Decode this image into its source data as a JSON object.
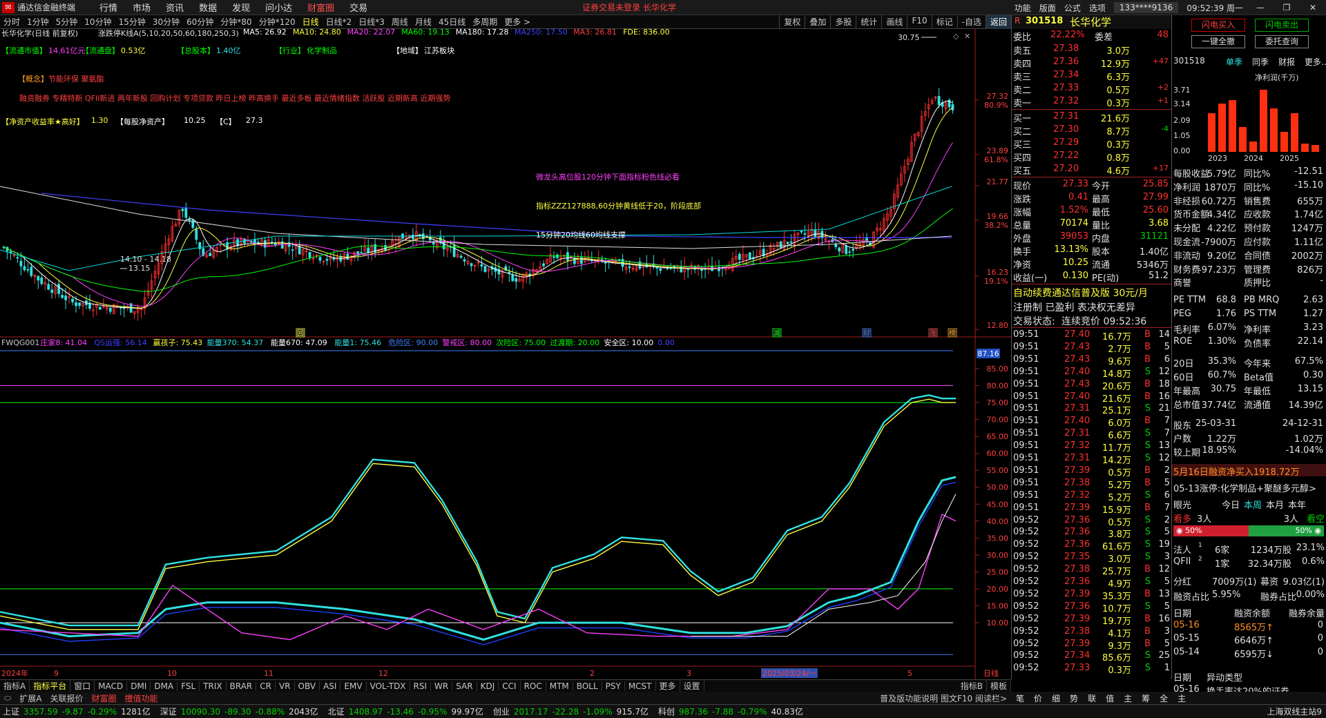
{
  "menubar": {
    "app": "通达信金融终端",
    "items": [
      "行情",
      "市场",
      "资讯",
      "数据",
      "发现",
      "问小达",
      "财富圈",
      "交易"
    ],
    "active": "财富圈",
    "warning": "证券交易未登录  长华化学",
    "right": [
      "功能",
      "版面",
      "公式",
      "选项"
    ],
    "account": "133****9136",
    "clock": "09:52:39 周一"
  },
  "periods": [
    "分时",
    "1分钟",
    "5分钟",
    "10分钟",
    "15分钟",
    "30分钟",
    "60分钟",
    "分钟*80",
    "分钟*120",
    "日线",
    "日线*2",
    "日线*3",
    "周线",
    "月线",
    "45日线",
    "多周期",
    "更多 >"
  ],
  "period_selected": "日线",
  "toolbar_right": [
    "复权",
    "叠加",
    "多股",
    "统计",
    "画线",
    "F10",
    "标记",
    "-自选",
    "返回"
  ],
  "chart_header": {
    "title": "长华化学(日线 前复权)",
    "indicator": "涨跌停K线A(5,10,20,50,60,180,250,3)",
    "ma": [
      {
        "t": "MA5: 26.92",
        "c": "#ffffff"
      },
      {
        "t": "MA10: 24.80",
        "c": "#ffff40"
      },
      {
        "t": "MA20: 22.07",
        "c": "#ff40ff"
      },
      {
        "t": "MA60: 19.13",
        "c": "#00ff00"
      },
      {
        "t": "MA180: 17.28",
        "c": "#ffffff"
      },
      {
        "t": "MA250: 17.50",
        "c": "#4040ff"
      },
      {
        "t": "MA3: 26.81",
        "c": "#ff4040"
      },
      {
        "t": "FDE: 836.00",
        "c": "#ffff40"
      }
    ]
  },
  "info": {
    "mktcap_label": "【流通市值】",
    "mktcap": "14.61亿元",
    "float_label": "【流通盘】",
    "float": "0.53亿",
    "total_label": "【总股本】",
    "total": "1.40亿",
    "ind_label": "【行业】",
    "ind": "化学制品",
    "region_label": "【地域】",
    "region": "江苏板块",
    "concept_label": "【概念】",
    "concept": "节能环保 聚氨酯",
    "tags": "融资融券 专精特新 QFII新进 两年新股 回购计划 专项贷款 昨日上榜 昨高换手 最近多板 最近情绪指数 活跃股 近期新高 近期强势",
    "roe_label": "【净资产收益率★高好】",
    "roe": "1.30",
    "bvps_label": "【每股净资产】",
    "bvps": "10.25",
    "c_label": "【C】",
    "c": "27.3"
  },
  "notes": [
    "微龙头高位股120分钟下面指标粉色线必看",
    "指标ZZZ127888,60分钟黄线低于20，阶段底部",
    "15分钟20均线60均线支撑"
  ],
  "price_labels": {
    "high": "30.75",
    "low": "13.15",
    "range": "14.10 - 14.18"
  },
  "y_axis_main": [
    {
      "v": "27.32",
      "p": "80.9%"
    },
    {
      "v": "23.89",
      "p": "61.8%"
    },
    {
      "v": "21.77",
      "p": ""
    },
    {
      "v": "19.66",
      "p": "38.2%"
    },
    {
      "v": "16.23",
      "p": "19.1%"
    },
    {
      "v": "12.80",
      "p": ""
    }
  ],
  "markers": [
    {
      "t": "回",
      "c": "#ffff40"
    },
    {
      "t": "减",
      "c": "#00ff00"
    },
    {
      "t": "财",
      "c": "#4080ff"
    },
    {
      "t": "涨",
      "c": "#ff4040"
    },
    {
      "t": "榜",
      "c": "#ffa020"
    }
  ],
  "sub_header": [
    {
      "t": "FWQG001",
      "c": "#c8c8c8"
    },
    {
      "t": "庄家8: 41.04",
      "c": "#ff40ff"
    },
    {
      "t": "QS运强: 56.14",
      "c": "#4040ff"
    },
    {
      "t": "赢孩子: 75.43",
      "c": "#ffff40"
    },
    {
      "t": "能量370: 54.37",
      "c": "#30e0e0"
    },
    {
      "t": "能量670: 47.09",
      "c": "#ffffff"
    },
    {
      "t": "能量1: 75.46",
      "c": "#30e0e0"
    },
    {
      "t": "危险区: 90.00",
      "c": "#4080ff"
    },
    {
      "t": "警戒区: 80.00",
      "c": "#ff40ff"
    },
    {
      "t": "次险区: 75.00",
      "c": "#00ff00"
    },
    {
      "t": "过渡期: 20.00",
      "c": "#00ff00"
    },
    {
      "t": "安全区: 10.00",
      "c": "#ffffff"
    },
    {
      "t": "0.00",
      "c": "#4040ff"
    }
  ],
  "y_axis_sub": [
    "85.00",
    "80.00",
    "75.00",
    "70.00",
    "65.00",
    "60.00",
    "55.00",
    "50.00",
    "45.00",
    "40.00",
    "35.00",
    "30.00",
    "25.00",
    "20.00",
    "15.00",
    "10.00"
  ],
  "sub_current": "87.16",
  "x_axis": [
    "2024年",
    "9",
    "10",
    "11",
    "12",
    "2",
    "3",
    "2025/03/24/一",
    "5",
    "日线"
  ],
  "bottom_tabs": [
    "指标A",
    "指标平台",
    "窗口",
    "MACD",
    "DMI",
    "DMA",
    "FSL",
    "TRIX",
    "BRAR",
    "CR",
    "VR",
    "OBV",
    "ASI",
    "EMV",
    "VOL-TDX",
    "RSI",
    "WR",
    "SAR",
    "KDJ",
    "CCI",
    "ROC",
    "MTM",
    "BOLL",
    "PSY",
    "MCST",
    "更多",
    "设置"
  ],
  "bottom_tabs_sel": "指标平台",
  "bottom_tabs_right": [
    "指标B",
    "模板"
  ],
  "bottom2": [
    "扩展A",
    "关联报价",
    "财富圈",
    "擅值功能"
  ],
  "bottom2_right": "普及版功能说明 图文F10 阅读栏>",
  "quote": {
    "code": "301518",
    "name": "长华化学",
    "wb_label": "委比",
    "wb": "22.22%",
    "wc_label": "委差",
    "wc": "48",
    "asks": [
      {
        "l": "卖五",
        "p": "27.38",
        "v": "3.0万",
        "d": ""
      },
      {
        "l": "卖四",
        "p": "27.36",
        "v": "12.9万",
        "d": "+47"
      },
      {
        "l": "卖三",
        "p": "27.34",
        "v": "6.3万",
        "d": ""
      },
      {
        "l": "卖二",
        "p": "27.33",
        "v": "0.5万",
        "d": "+2"
      },
      {
        "l": "卖一",
        "p": "27.32",
        "v": "0.3万",
        "d": "+1"
      }
    ],
    "bids": [
      {
        "l": "买一",
        "p": "27.31",
        "v": "21.6万",
        "d": ""
      },
      {
        "l": "买二",
        "p": "27.30",
        "v": "8.7万",
        "d": "-4"
      },
      {
        "l": "买三",
        "p": "27.29",
        "v": "0.3万",
        "d": ""
      },
      {
        "l": "买四",
        "p": "27.22",
        "v": "0.8万",
        "d": ""
      },
      {
        "l": "买五",
        "p": "27.20",
        "v": "4.6万",
        "d": "+17"
      }
    ],
    "stats": [
      [
        "现价",
        "27.33",
        "今开",
        "25.85"
      ],
      [
        "涨跌",
        "0.41",
        "最高",
        "27.99"
      ],
      [
        "涨幅",
        "1.52%",
        "最低",
        "25.60"
      ],
      [
        "总量",
        "70174",
        "量比",
        "3.68"
      ],
      [
        "外盘",
        "39053",
        "内盘",
        "31121"
      ],
      [
        "换手",
        "13.13%",
        "股本",
        "1.40亿"
      ],
      [
        "净资",
        "10.25",
        "流通",
        "5346万"
      ],
      [
        "收益(一)",
        "0.130",
        "PE(动)",
        "51.2"
      ]
    ],
    "ad1": "自动续费通达信普及版  30元/月",
    "ad2": "注册制 已盈利 表决权无差异",
    "state_label": "交易状态:",
    "state": "连续竞价 09:52:36"
  },
  "ticks": [
    [
      "09:51",
      "27.40",
      "16.7万",
      "B",
      "14"
    ],
    [
      "09:51",
      "27.43",
      "2.7万",
      "B",
      "5"
    ],
    [
      "09:51",
      "27.43",
      "9.6万",
      "B",
      "6"
    ],
    [
      "09:51",
      "27.40",
      "14.8万",
      "S",
      "12"
    ],
    [
      "09:51",
      "27.43",
      "20.6万",
      "B",
      "18"
    ],
    [
      "09:51",
      "27.40",
      "21.6万",
      "B",
      "16"
    ],
    [
      "09:51",
      "27.31",
      "25.1万",
      "S",
      "21"
    ],
    [
      "09:51",
      "27.40",
      "6.0万",
      "B",
      "7"
    ],
    [
      "09:51",
      "27.31",
      "6.6万",
      "S",
      "7"
    ],
    [
      "09:51",
      "27.32",
      "11.7万",
      "S",
      "13"
    ],
    [
      "09:51",
      "27.31",
      "14.2万",
      "S",
      "12"
    ],
    [
      "09:51",
      "27.39",
      "0.5万",
      "B",
      "2"
    ],
    [
      "09:51",
      "27.38",
      "5.2万",
      "B",
      "5"
    ],
    [
      "09:51",
      "27.32",
      "5.2万",
      "S",
      "6"
    ],
    [
      "09:51",
      "27.39",
      "15.9万",
      "B",
      "7"
    ],
    [
      "09:52",
      "27.36",
      "0.5万",
      "S",
      "2"
    ],
    [
      "09:52",
      "27.36",
      "3.8万",
      "S",
      "5"
    ],
    [
      "09:52",
      "27.36",
      "61.6万",
      "S",
      "19"
    ],
    [
      "09:52",
      "27.35",
      "3.0万",
      "S",
      "3"
    ],
    [
      "09:52",
      "27.38",
      "25.7万",
      "B",
      "12"
    ],
    [
      "09:52",
      "27.36",
      "4.9万",
      "S",
      "5"
    ],
    [
      "09:52",
      "27.39",
      "35.3万",
      "B",
      "13"
    ],
    [
      "09:52",
      "27.36",
      "10.7万",
      "S",
      "5"
    ],
    [
      "09:52",
      "27.39",
      "19.7万",
      "B",
      "16"
    ],
    [
      "09:52",
      "27.38",
      "4.1万",
      "B",
      "3"
    ],
    [
      "09:52",
      "27.39",
      "9.3万",
      "B",
      "5"
    ],
    [
      "09:52",
      "27.34",
      "85.6万",
      "S",
      "25"
    ],
    [
      "09:52",
      "27.33",
      "0.3万",
      "S",
      "1"
    ]
  ],
  "f10": {
    "btn1": "闪电买入",
    "btn2": "闪电卖出",
    "btn3": "一键全撤",
    "btn4": "委托查询",
    "code": "301518",
    "tabs": [
      "单季",
      "同季",
      "财报",
      "更多.."
    ],
    "chart_title": "净利润(千万)",
    "ylabels": [
      "3.71",
      "3.14",
      "2.09",
      "1.05",
      "0.00"
    ],
    "years": [
      "2023",
      "2024",
      "2025"
    ],
    "bars": [
      2.3,
      2.9,
      3.1,
      1.5,
      0.6,
      3.71,
      2.6,
      1.2,
      2.3,
      0.5,
      0.4
    ],
    "rows": [
      [
        "每股收益",
        "5.79亿",
        "同比%",
        "-12.51"
      ],
      [
        "净利润",
        "1870万",
        "同比%",
        "-15.10"
      ],
      [
        "非经损",
        "60.72万",
        "销售费",
        "655万"
      ],
      [
        "货币金额",
        "4.34亿",
        "应收款",
        "1.74亿"
      ],
      [
        "未分配",
        "4.22亿",
        "预付款",
        "1247万"
      ],
      [
        "现金流",
        "-7900万",
        "应付款",
        "1.11亿"
      ],
      [
        "非流动",
        "9.20亿",
        "合同债",
        "2002万"
      ],
      [
        "财务费",
        "-97.23万",
        "管理费",
        "826万"
      ],
      [
        "商誉",
        "",
        "质押比",
        "-"
      ]
    ],
    "pe": [
      [
        "PE TTM",
        "68.8",
        "PB MRQ",
        "2.63"
      ],
      [
        "PEG",
        "1.76",
        "PS TTM",
        "1.27"
      ],
      [
        "毛利率",
        "6.07%",
        "净利率",
        "3.23"
      ],
      [
        "ROE",
        "1.30%",
        "负债率",
        "22.14"
      ]
    ],
    "range": [
      [
        "20日",
        "35.3%",
        "今年来",
        "67.5%"
      ],
      [
        "60日",
        "60.7%",
        "Beta值",
        "0.30"
      ],
      [
        "年最高",
        "30.75",
        "年最低",
        "13.15"
      ],
      [
        "总市值",
        "37.74亿",
        "流通值",
        "14.39亿"
      ]
    ],
    "holders": [
      [
        "股东",
        "25-03-31",
        "",
        "24-12-31"
      ],
      [
        "户数",
        "1.22万",
        "",
        "1.02万"
      ],
      [
        "较上期",
        "18.95%",
        "",
        "-14.04%"
      ]
    ],
    "margin_text": "5月16日融资净买入1918.72万",
    "limit_text": "05-13涨停:化学制品+聚醚多元醇>",
    "views_tabs": [
      "眼光",
      "今日",
      "本周",
      "本月",
      "本年"
    ],
    "bull_label": "看多",
    "bull_n": "3人",
    "bear_n": "3人",
    "bear_label": "看空",
    "bull_pct": "50%",
    "bear_pct": "50%",
    "inst": [
      [
        "法人",
        "1",
        "6家",
        "1234万股",
        "23.1%"
      ],
      [
        "QFII",
        "2",
        "1家",
        "32.34万股",
        "0.6%"
      ]
    ],
    "div": [
      "分红",
      "7009万(1)",
      "募资",
      "9.03亿(1)"
    ],
    "fin": [
      "融资占比",
      "5.95%",
      "融券占比",
      "0.00%"
    ],
    "mtable_head": [
      "日期",
      "融资余额",
      "融券余量"
    ],
    "mtable": [
      [
        "05-16",
        "8565万↑",
        "0"
      ],
      [
        "05-15",
        "6646万↑",
        "0"
      ],
      [
        "05-14",
        "6595万↓",
        "0"
      ]
    ],
    "anom_head": [
      "日期",
      "异动类型"
    ],
    "anom": [
      "05-16",
      "换手率达20%的证券"
    ]
  },
  "right_tabs": [
    "笔",
    "价",
    "细",
    "势",
    "联",
    "值",
    "主",
    "筹",
    "全",
    "主"
  ],
  "status": [
    {
      "l": "上证",
      "v": "3357.59",
      "c": "-9.87",
      "p": "-0.29%",
      "a": "1281亿"
    },
    {
      "l": "深证",
      "v": "10090.30",
      "c": "-89.30",
      "p": "-0.88%",
      "a": "2043亿"
    },
    {
      "l": "北证",
      "v": "1408.97",
      "c": "-13.46",
      "p": "-0.95%",
      "a": "99.97亿"
    },
    {
      "l": "创业",
      "v": "2017.17",
      "c": "-22.28",
      "p": "-1.09%",
      "a": "915.7亿"
    },
    {
      "l": "科创",
      "v": "987.36",
      "c": "-7.88",
      "p": "-0.79%",
      "a": "40.83亿"
    }
  ],
  "status_right": "上海双线主站9"
}
